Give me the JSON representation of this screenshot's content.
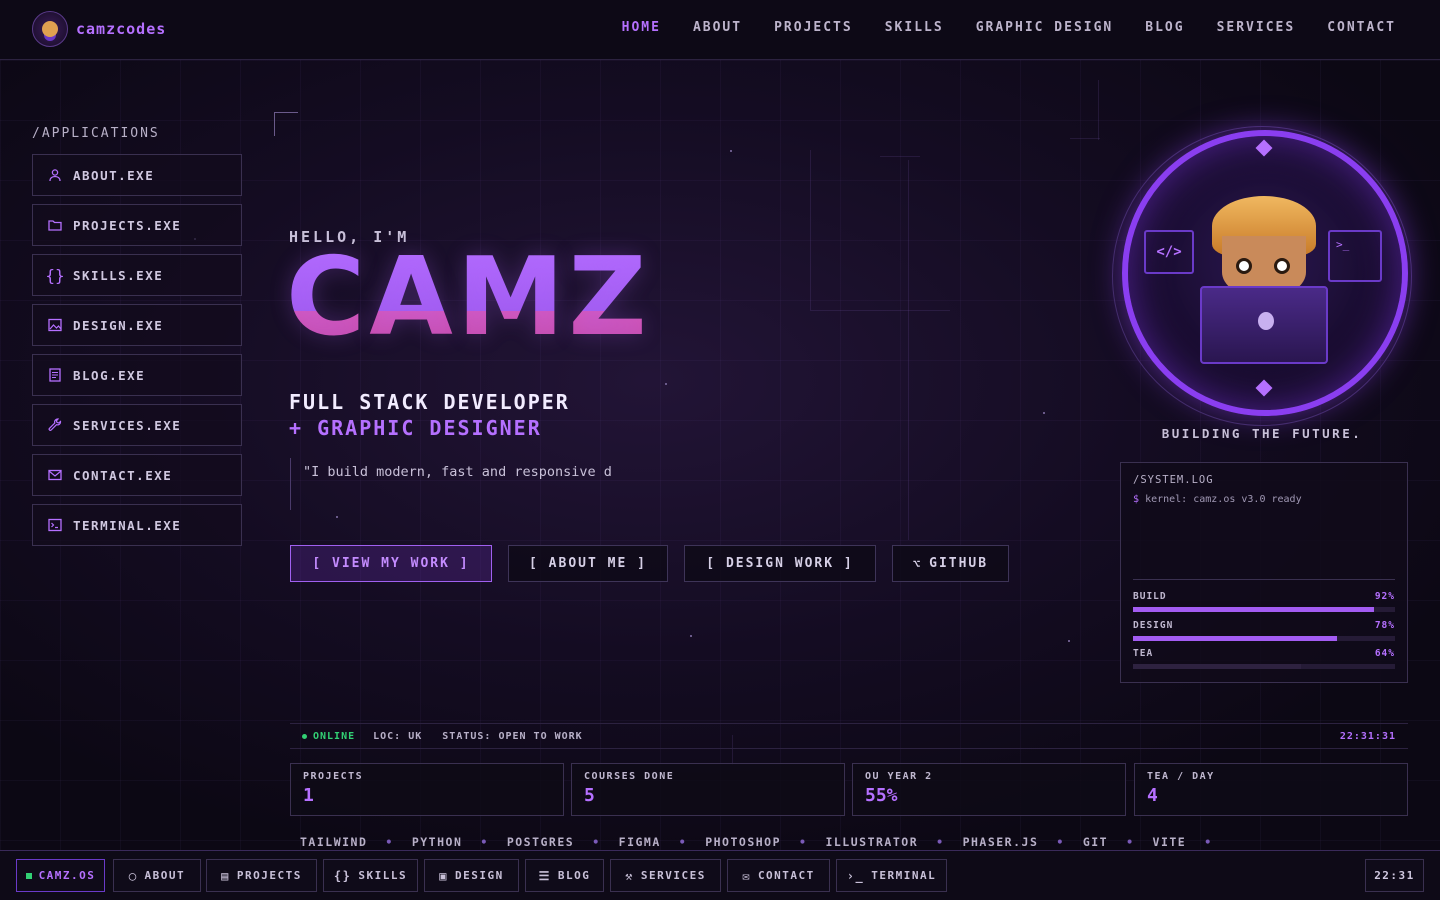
{
  "brand": {
    "name": "camzcodes"
  },
  "nav": {
    "items": [
      {
        "label": "HOME",
        "active": true
      },
      {
        "label": "ABOUT"
      },
      {
        "label": "PROJECTS"
      },
      {
        "label": "SKILLS"
      },
      {
        "label": "GRAPHIC DESIGN"
      },
      {
        "label": "BLOG"
      },
      {
        "label": "SERVICES"
      },
      {
        "label": "CONTACT"
      }
    ]
  },
  "sidebar": {
    "title": "/APPLICATIONS",
    "items": [
      {
        "label": "ABOUT.EXE",
        "icon": "user-icon"
      },
      {
        "label": "PROJECTS.EXE",
        "icon": "folder-icon"
      },
      {
        "label": "SKILLS.EXE",
        "icon": "braces-icon"
      },
      {
        "label": "DESIGN.EXE",
        "icon": "image-icon"
      },
      {
        "label": "BLOG.EXE",
        "icon": "document-icon"
      },
      {
        "label": "SERVICES.EXE",
        "icon": "wrench-icon"
      },
      {
        "label": "CONTACT.EXE",
        "icon": "mail-icon"
      },
      {
        "label": "TERMINAL.EXE",
        "icon": "terminal-icon"
      }
    ]
  },
  "hero": {
    "greeting": "HELLO, I'M",
    "name": "CAMZ",
    "role_line1": "FULL STACK DEVELOPER",
    "role_line2": "+ GRAPHIC DESIGNER",
    "quote": "\"I build modern, fast and responsive d",
    "buttons": {
      "view_work": "[ VIEW MY WORK ]",
      "about_me": "[ ABOUT ME ]",
      "design_work": "[ DESIGN WORK ]",
      "github": "GITHUB"
    }
  },
  "avatar": {
    "caption": "BUILDING THE FUTURE."
  },
  "syslog": {
    "title": "/SYSTEM.LOG",
    "prompt": "$",
    "line": "kernel: camz.os v3.0 ready",
    "meters": [
      {
        "name": "BUILD",
        "value_label": "92%",
        "value": 0.92
      },
      {
        "name": "DESIGN",
        "value_label": "78%",
        "value": 0.78
      },
      {
        "name": "TEA",
        "value_label": "64%",
        "value": 0.64
      }
    ]
  },
  "status": {
    "online": "ONLINE",
    "loc": "LOC: UK",
    "status": "STATUS: OPEN TO WORK",
    "clock": "22:31:31"
  },
  "stats": [
    {
      "label": "PROJECTS",
      "value": "1"
    },
    {
      "label": "COURSES DONE",
      "value": "5"
    },
    {
      "label": "OU YEAR 2",
      "value": "55%"
    },
    {
      "label": "TEA / DAY",
      "value": "4"
    }
  ],
  "ticker": [
    "TAILWIND",
    "PYTHON",
    "POSTGRES",
    "FIGMA",
    "PHOTOSHOP",
    "ILLUSTRATOR",
    "PHASER.JS",
    "GIT",
    "VITE"
  ],
  "taskbar": {
    "os": "CAMZ.OS",
    "items": [
      {
        "label": "ABOUT",
        "icon": "user-icon"
      },
      {
        "label": "PROJECTS",
        "icon": "folder-icon"
      },
      {
        "label": "SKILLS",
        "icon": "braces-icon"
      },
      {
        "label": "DESIGN",
        "icon": "image-icon"
      },
      {
        "label": "BLOG",
        "icon": "document-icon"
      },
      {
        "label": "SERVICES",
        "icon": "wrench-icon"
      },
      {
        "label": "CONTACT",
        "icon": "mail-icon"
      },
      {
        "label": "TERMINAL",
        "icon": "terminal-icon"
      }
    ],
    "clock": "22:31"
  },
  "colors": {
    "accent": "#b570ff",
    "online": "#32d074",
    "background": "#0c0814"
  }
}
